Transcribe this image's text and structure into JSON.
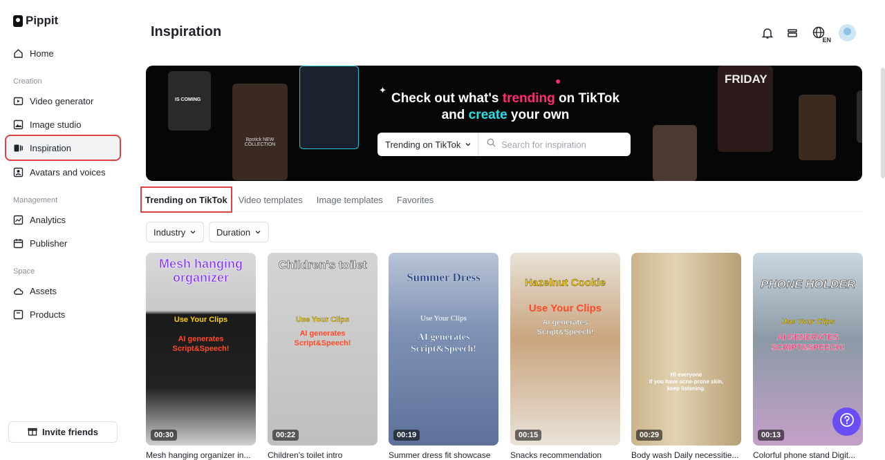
{
  "app": {
    "name": "Pippit"
  },
  "sidebar": {
    "home": "Home",
    "sections": {
      "creation": "Creation",
      "management": "Management",
      "space": "Space"
    },
    "creation_items": [
      "Video generator",
      "Image studio",
      "Inspiration",
      "Avatars and voices"
    ],
    "management_items": [
      "Analytics",
      "Publisher"
    ],
    "space_items": [
      "Assets",
      "Products"
    ],
    "invite": "Invite friends"
  },
  "header": {
    "title": "Inspiration",
    "lang": "EN"
  },
  "banner": {
    "line1_a": "Check out what's ",
    "line1_b": "trending",
    "line1_c": " on TikTok",
    "line2_a": "and ",
    "line2_b": "create",
    "line2_c": " your own",
    "dropdown": "Trending on TikTok",
    "search_placeholder": "Search for inspiration",
    "deco_texts": [
      "IS COMING",
      "FRIDAY",
      "Bpstick NEW COLLECTION"
    ]
  },
  "tabs": [
    "Trending on TikTok",
    "Video templates",
    "Image templates",
    "Favorites"
  ],
  "filters": [
    "Industry",
    "Duration"
  ],
  "cards": [
    {
      "title": "Mesh hanging organizer",
      "sub1": "Use Your Clips",
      "sub2": "AI generates Script&Speech!",
      "duration": "00:30",
      "caption": "Mesh hanging organizer in..."
    },
    {
      "title": "Children's toilet",
      "sub1": "Use Your Clips",
      "sub2": "AI generates Script&Speech!",
      "duration": "00:22",
      "caption": "Children's toilet intro"
    },
    {
      "title": "Summer Dress",
      "sub1": "Use Your Clips",
      "sub2": "AI generates Script&Speech!",
      "duration": "00:19",
      "caption": "Summer dress fit showcase"
    },
    {
      "title": "Hazelnut Cookie",
      "sub1": "Use Your Clips",
      "sub2": "AI generates Script&Speech!",
      "duration": "00:15",
      "caption": "Snacks recommendation"
    },
    {
      "title": "",
      "sub1": "Hi everyone",
      "sub2": "if you have acne-prone skin, keep listening.",
      "duration": "00:29",
      "caption": "Body wash Daily necessitie..."
    },
    {
      "title": "PHONE HOLDER",
      "sub1": "Use Your Clips",
      "sub2": "AI GENERATES SCRIPT&SPEECH!",
      "duration": "00:13",
      "caption": "Colorful phone stand Digit..."
    }
  ]
}
